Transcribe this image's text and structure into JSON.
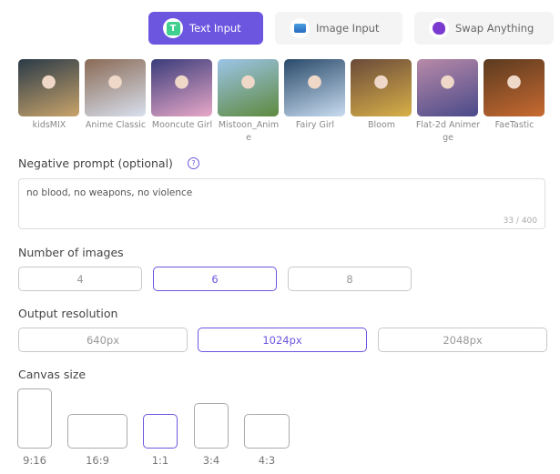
{
  "tabs": [
    {
      "label": "Text Input",
      "icon": "text-t-icon",
      "active": true
    },
    {
      "label": "Image Input",
      "icon": "image-icon",
      "active": false
    },
    {
      "label": "Swap Anything",
      "icon": "palette-icon",
      "active": false
    }
  ],
  "models": [
    {
      "label": "kidsMIX",
      "colors": [
        "#2a3a48",
        "#c9a46a"
      ]
    },
    {
      "label": "Anime Classic",
      "colors": [
        "#8a6a55",
        "#d8e0ee"
      ]
    },
    {
      "label": "Mooncute Girl",
      "colors": [
        "#3a3c7a",
        "#e8a8c8"
      ]
    },
    {
      "label": "Mistoon_Anime",
      "colors": [
        "#9cc4e8",
        "#5e8a3e"
      ]
    },
    {
      "label": "Fairy Girl",
      "colors": [
        "#2a4a6a",
        "#c8dcf0"
      ]
    },
    {
      "label": "Bloom",
      "colors": [
        "#6a4a3a",
        "#d8b048"
      ]
    },
    {
      "label": "Flat-2d Animerge",
      "colors": [
        "#b88aa8",
        "#4a4a8a"
      ]
    },
    {
      "label": "FaeTastic",
      "colors": [
        "#5a3a20",
        "#c86a30"
      ]
    }
  ],
  "negative_prompt": {
    "label": "Negative prompt (optional)",
    "value": "no blood, no weapons, no violence",
    "counter": "33 / 400",
    "help_icon": "question-circle-icon"
  },
  "num_images": {
    "label": "Number of images",
    "options": [
      "4",
      "6",
      "8"
    ],
    "selected": "6"
  },
  "resolution": {
    "label": "Output resolution",
    "options": [
      "640px",
      "1024px",
      "2048px"
    ],
    "selected": "1024px"
  },
  "canvas": {
    "label": "Canvas size",
    "options": [
      "9:16",
      "16:9",
      "1:1",
      "3:4",
      "4:3"
    ],
    "selected": "1:1"
  },
  "accent": "#6c56e0"
}
